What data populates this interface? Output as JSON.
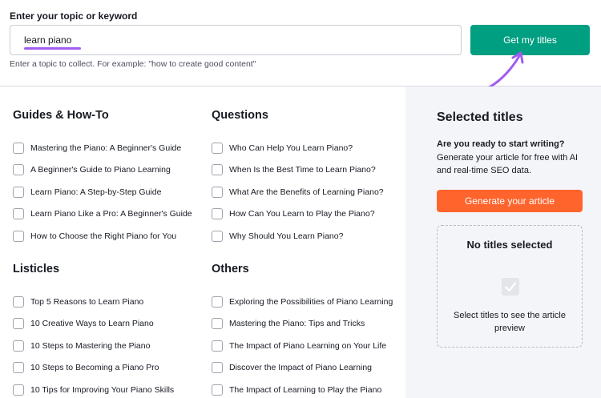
{
  "search": {
    "label": "Enter your topic or keyword",
    "value": "learn piano",
    "hint": "Enter a topic to collect. For example: \"how to create good content\"",
    "button_label": "Get my titles"
  },
  "colors": {
    "primary_green": "#009f81",
    "accent_orange": "#ff642d",
    "highlight_purple": "#a15cf0",
    "panel_bg": "#f4f5f9"
  },
  "sections": {
    "guides": {
      "title": "Guides & How-To",
      "items": [
        "Mastering the Piano: A Beginner's Guide",
        "A Beginner's Guide to Piano Learning",
        "Learn Piano: A Step-by-Step Guide",
        "Learn Piano Like a Pro: A Beginner's Guide",
        "How to Choose the Right Piano for You"
      ]
    },
    "questions": {
      "title": "Questions",
      "items": [
        "Who Can Help You Learn Piano?",
        "When Is the Best Time to Learn Piano?",
        "What Are the Benefits of Learning Piano?",
        "How Can You Learn to Play the Piano?",
        "Why Should You Learn Piano?"
      ]
    },
    "listicles": {
      "title": "Listicles",
      "items": [
        "Top 5 Reasons to Learn Piano",
        "10 Creative Ways to Learn Piano",
        "10 Steps to Mastering the Piano",
        "10 Steps to Becoming a Piano Pro",
        "10 Tips for Improving Your Piano Skills"
      ]
    },
    "others": {
      "title": "Others",
      "items": [
        "Exploring the Possibilities of Piano Learning",
        "Mastering the Piano: Tips and Tricks",
        "The Impact of Piano Learning on Your Life",
        "Discover the Impact of Piano Learning",
        "The Impact of Learning to Play the Piano"
      ]
    }
  },
  "panel": {
    "title": "Selected titles",
    "prompt": "Are you ready to start writing?",
    "description": "Generate your article for free with AI and real-time SEO data.",
    "generate_label": "Generate your article",
    "empty_title": "No titles selected",
    "empty_text": "Select titles to see the article preview"
  }
}
